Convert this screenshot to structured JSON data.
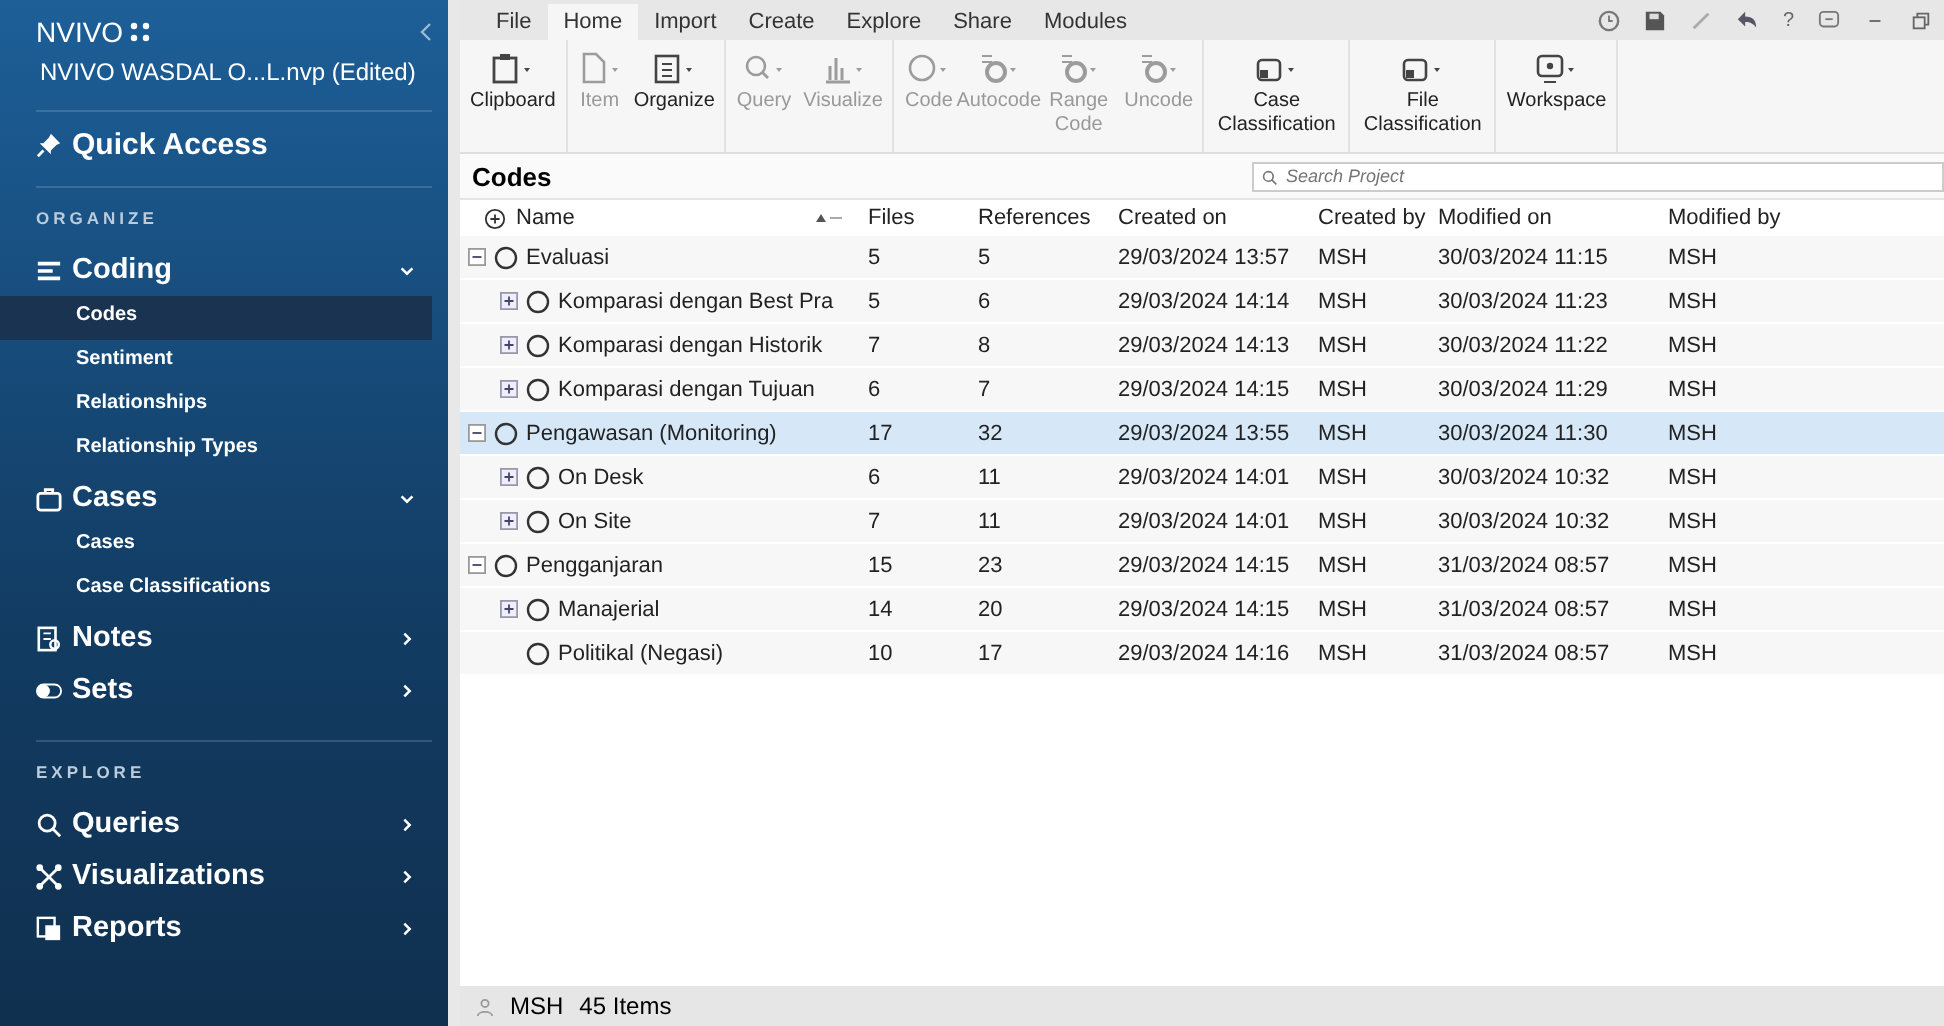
{
  "sidebar": {
    "logo": "NVIVO",
    "project": "NVIVO WASDAL O...L.nvp (Edited)",
    "quick_access": "Quick Access",
    "sections": [
      {
        "title": "ORGANIZE",
        "groups": [
          {
            "label": "Coding",
            "expanded": true,
            "children": [
              {
                "label": "Codes",
                "selected": true
              },
              {
                "label": "Sentiment",
                "selected": false
              },
              {
                "label": "Relationships",
                "selected": false
              },
              {
                "label": "Relationship Types",
                "selected": false
              }
            ]
          },
          {
            "label": "Cases",
            "expanded": true,
            "children": [
              {
                "label": "Cases",
                "selected": false
              },
              {
                "label": "Case Classifications",
                "selected": false
              }
            ]
          },
          {
            "label": "Notes",
            "expanded": false
          },
          {
            "label": "Sets",
            "expanded": false
          }
        ]
      },
      {
        "title": "EXPLORE",
        "groups": [
          {
            "label": "Queries",
            "expanded": false
          },
          {
            "label": "Visualizations",
            "expanded": false
          },
          {
            "label": "Reports",
            "expanded": false
          }
        ]
      }
    ]
  },
  "ribbon": {
    "tabs": [
      {
        "label": "File",
        "selected": false
      },
      {
        "label": "Home",
        "selected": true
      },
      {
        "label": "Import",
        "selected": false
      },
      {
        "label": "Create",
        "selected": false
      },
      {
        "label": "Explore",
        "selected": false
      },
      {
        "label": "Share",
        "selected": false
      },
      {
        "label": "Modules",
        "selected": false
      }
    ],
    "help": "?",
    "groups": [
      [
        {
          "label": "Clipboard",
          "disabled": false
        }
      ],
      [
        {
          "label": "Item",
          "disabled": true
        },
        {
          "label": "Organize",
          "disabled": false
        }
      ],
      [
        {
          "label": "Query",
          "disabled": true
        },
        {
          "label": "Visualize",
          "disabled": true
        }
      ],
      [
        {
          "label": "Code",
          "disabled": true
        },
        {
          "label": "Autocode",
          "disabled": true
        },
        {
          "label": "Range Code",
          "disabled": true
        },
        {
          "label": "Uncode",
          "disabled": true
        }
      ],
      [
        {
          "label": "Case Classification",
          "disabled": false
        }
      ],
      [
        {
          "label": "File Classification",
          "disabled": false
        }
      ],
      [
        {
          "label": "Workspace",
          "disabled": false
        }
      ]
    ]
  },
  "view": {
    "title": "Codes",
    "search": {
      "placeholder": "Search Project"
    }
  },
  "table": {
    "columns": [
      "Name",
      "Files",
      "References",
      "Created on",
      "Created by",
      "Modified on",
      "Modified by"
    ],
    "rows": [
      {
        "name": "Evaluasi",
        "files": "5",
        "references": "5",
        "created_on": "29/03/2024 13:57",
        "created_by": "MSH",
        "modified_on": "30/03/2024 11:15",
        "modified_by": "MSH",
        "selected": false,
        "expanded": true,
        "children": [
          {
            "name": "Komparasi dengan Best Pra",
            "files": "5",
            "references": "6",
            "created_on": "29/03/2024 14:14",
            "created_by": "MSH",
            "modified_on": "30/03/2024 11:23",
            "modified_by": "MSH",
            "selected": false,
            "expanded": false
          },
          {
            "name": "Komparasi dengan Historik",
            "files": "7",
            "references": "8",
            "created_on": "29/03/2024 14:13",
            "created_by": "MSH",
            "modified_on": "30/03/2024 11:22",
            "modified_by": "MSH",
            "selected": false,
            "expanded": false
          },
          {
            "name": "Komparasi dengan Tujuan",
            "files": "6",
            "references": "7",
            "created_on": "29/03/2024 14:15",
            "created_by": "MSH",
            "modified_on": "30/03/2024 11:29",
            "modified_by": "MSH",
            "selected": false,
            "expanded": false
          }
        ]
      },
      {
        "name": "Pengawasan (Monitoring)",
        "files": "17",
        "references": "32",
        "created_on": "29/03/2024 13:55",
        "created_by": "MSH",
        "modified_on": "30/03/2024 11:30",
        "modified_by": "MSH",
        "selected": true,
        "expanded": true,
        "children": [
          {
            "name": "On Desk",
            "files": "6",
            "references": "11",
            "created_on": "29/03/2024 14:01",
            "created_by": "MSH",
            "modified_on": "30/03/2024 10:32",
            "modified_by": "MSH",
            "selected": false,
            "expanded": false
          },
          {
            "name": "On Site",
            "files": "7",
            "references": "11",
            "created_on": "29/03/2024 14:01",
            "created_by": "MSH",
            "modified_on": "30/03/2024 10:32",
            "modified_by": "MSH",
            "selected": false,
            "expanded": false
          }
        ]
      },
      {
        "name": "Pengganjaran",
        "files": "15",
        "references": "23",
        "created_on": "29/03/2024 14:15",
        "created_by": "MSH",
        "modified_on": "31/03/2024 08:57",
        "modified_by": "MSH",
        "selected": false,
        "expanded": true,
        "children": [
          {
            "name": "Manajerial",
            "files": "14",
            "references": "20",
            "created_on": "29/03/2024 14:15",
            "created_by": "MSH",
            "modified_on": "31/03/2024 08:57",
            "modified_by": "MSH",
            "selected": false,
            "expanded": false
          },
          {
            "name": "Politikal (Negasi)",
            "files": "10",
            "references": "17",
            "created_on": "29/03/2024 14:16",
            "created_by": "MSH",
            "modified_on": "31/03/2024 08:57",
            "modified_by": "MSH",
            "selected": false
          }
        ]
      }
    ]
  },
  "status_bar": {
    "user": "MSH",
    "count": "45 Items"
  }
}
